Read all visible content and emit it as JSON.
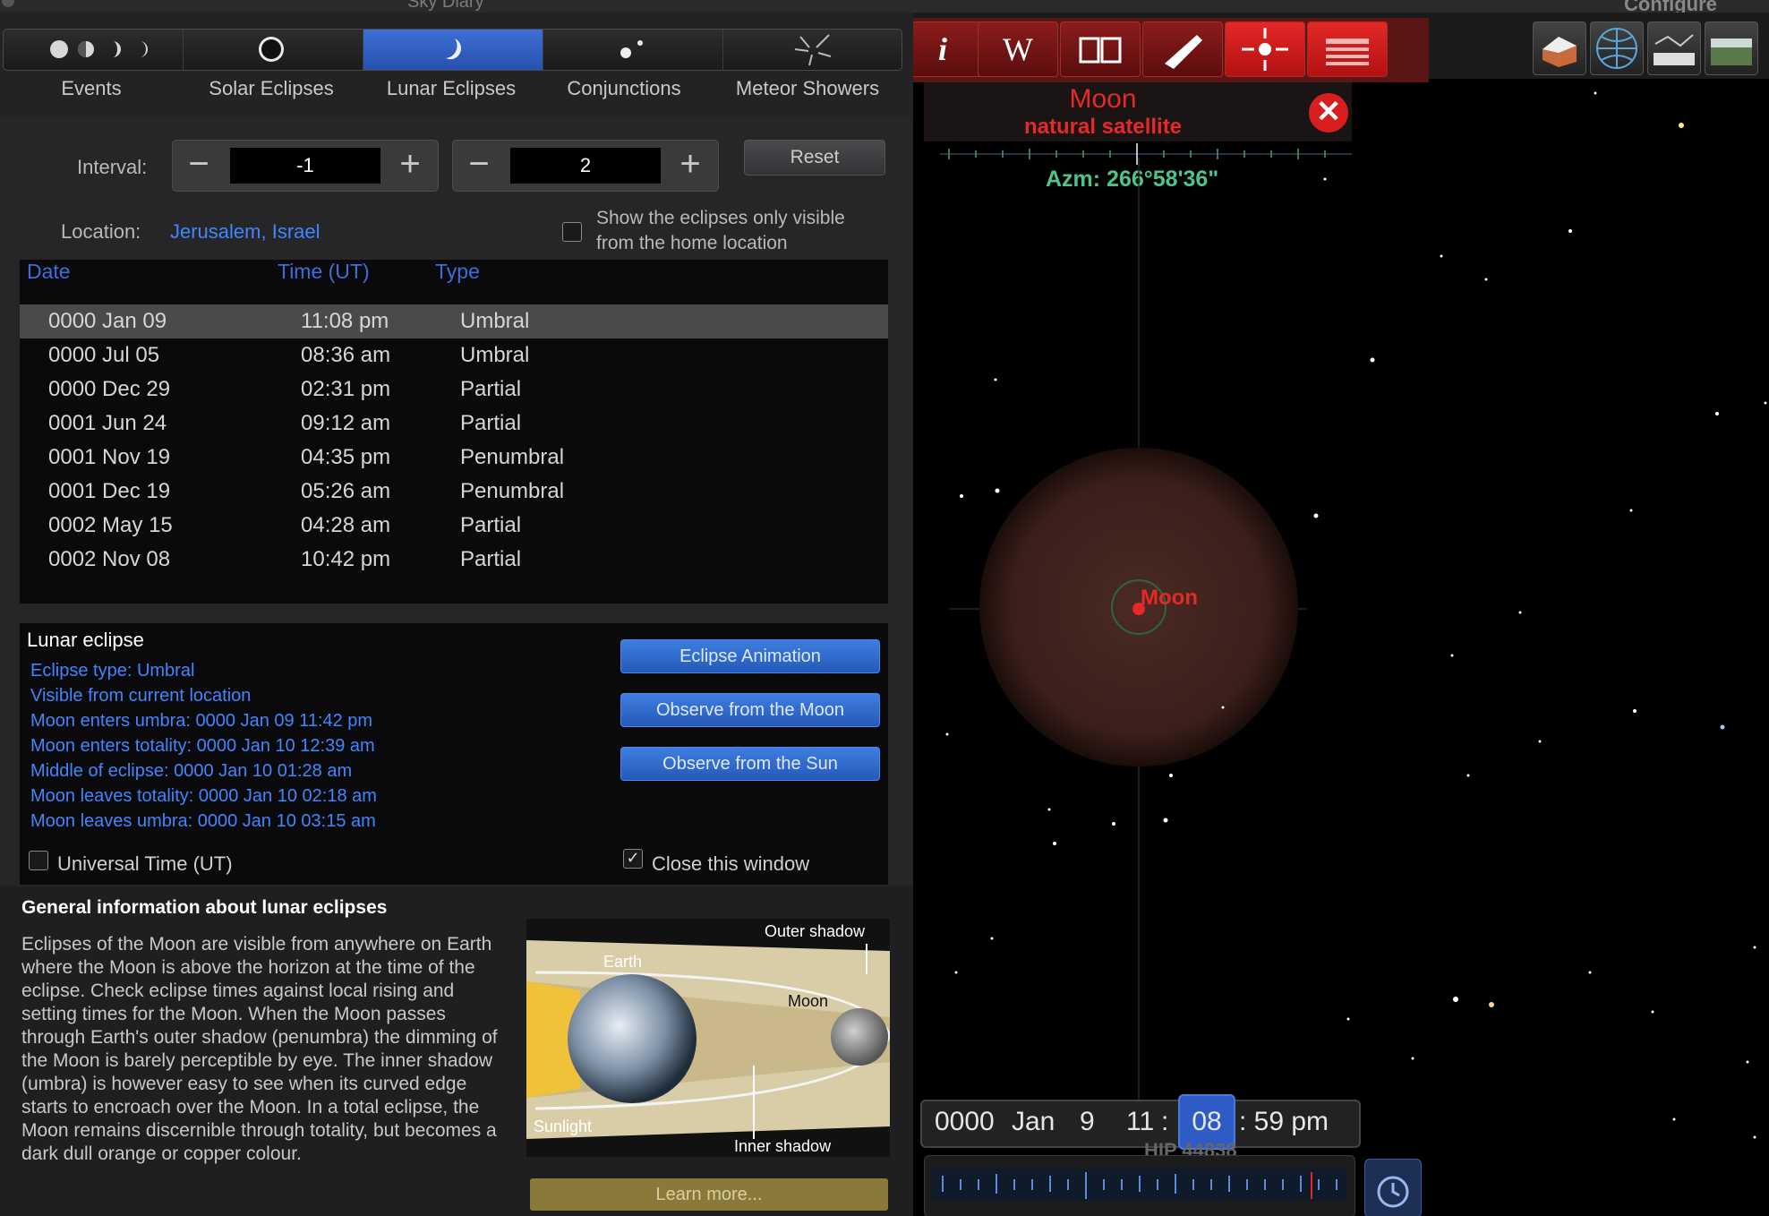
{
  "window": {
    "title": "Sky Diary"
  },
  "tabs": [
    {
      "label": "Events",
      "icon": "moon-phases-icon"
    },
    {
      "label": "Solar Eclipses",
      "icon": "solar-eclipse-icon"
    },
    {
      "label": "Lunar Eclipses",
      "icon": "lunar-eclipse-icon",
      "active": true
    },
    {
      "label": "Conjunctions",
      "icon": "conjunction-icon"
    },
    {
      "label": "Meteor Showers",
      "icon": "meteor-shower-icon"
    }
  ],
  "controls": {
    "interval_label": "Interval:",
    "interval_from": "-1",
    "interval_to": "2",
    "reset_label": "Reset",
    "location_label": "Location:",
    "location_value": "Jerusalem, Israel",
    "home_only_label_1": "Show the eclipses only visible",
    "home_only_label_2": "from the home location"
  },
  "table": {
    "headers": {
      "date": "Date",
      "time": "Time (UT)",
      "type": "Type"
    },
    "rows": [
      {
        "date": "0000 Jan 09",
        "time": "11:08 pm",
        "type": "Umbral",
        "selected": true
      },
      {
        "date": "0000 Jul 05",
        "time": "08:36 am",
        "type": "Umbral"
      },
      {
        "date": "0000 Dec 29",
        "time": "02:31 pm",
        "type": "Partial"
      },
      {
        "date": "0001 Jun 24",
        "time": "09:12 am",
        "type": "Partial"
      },
      {
        "date": "0001 Nov 19",
        "time": "04:35 pm",
        "type": "Penumbral"
      },
      {
        "date": "0001 Dec 19",
        "time": "05:26 am",
        "type": "Penumbral"
      },
      {
        "date": "0002 May 15",
        "time": "04:28 am",
        "type": "Partial"
      },
      {
        "date": "0002 Nov 08",
        "time": "10:42 pm",
        "type": "Partial"
      }
    ]
  },
  "details": {
    "title": "Lunar eclipse",
    "lines": [
      "Eclipse type: Umbral",
      "Visible from current location",
      "Moon enters umbra:  0000 Jan 09 11:42 pm",
      "Moon enters totality:  0000 Jan 10 12:39 am",
      "Middle of eclipse:  0000 Jan 10 01:28 am",
      "Moon leaves totality: 0000 Jan 10 02:18 am",
      "Moon leaves umbra: 0000 Jan 10 03:15 am"
    ],
    "btn_animation": "Eclipse Animation",
    "btn_moon": "Observe from the Moon",
    "btn_sun": "Observe from the Sun",
    "ut_label": "Universal Time (UT)",
    "close_label": "Close this window"
  },
  "info": {
    "title": "General information about lunar eclipses",
    "text": "Eclipses of the Moon are visible from anywhere on Earth where the Moon is above the horizon at the time of the eclipse. Check eclipse times against local rising and setting times for the Moon. When the Moon passes through Earth's outer shadow (penumbra) the dimming of the Moon is barely perceptible by eye. The inner shadow (umbra) is however easy to see when its curved edge starts to encroach over the Moon. In a total eclipse, the Moon remains discernible through totality, but becomes a dark dull orange or copper colour.",
    "diagram": {
      "outer_shadow": "Outer shadow",
      "earth": "Earth",
      "moon": "Moon",
      "sunlight": "Sunlight",
      "inner_shadow": "Inner shadow"
    },
    "learn_more": "Learn more..."
  },
  "sky": {
    "configure": "Configure",
    "object_name": "Moon",
    "object_kind": "natural satellite",
    "azimuth": "Azm: 266°58'36\"",
    "moon_label": "Moon",
    "time": {
      "year": "0000",
      "month": "Jan",
      "day": "9",
      "hour": "11",
      "minute": "08",
      "second": ": 59 pm",
      "sep": ":"
    },
    "star_label": "HIP 44838"
  },
  "colors": {
    "accent": "#3e6fd6",
    "link": "#3f86ff",
    "red": "#e52828",
    "azm": "#4fc48a"
  }
}
